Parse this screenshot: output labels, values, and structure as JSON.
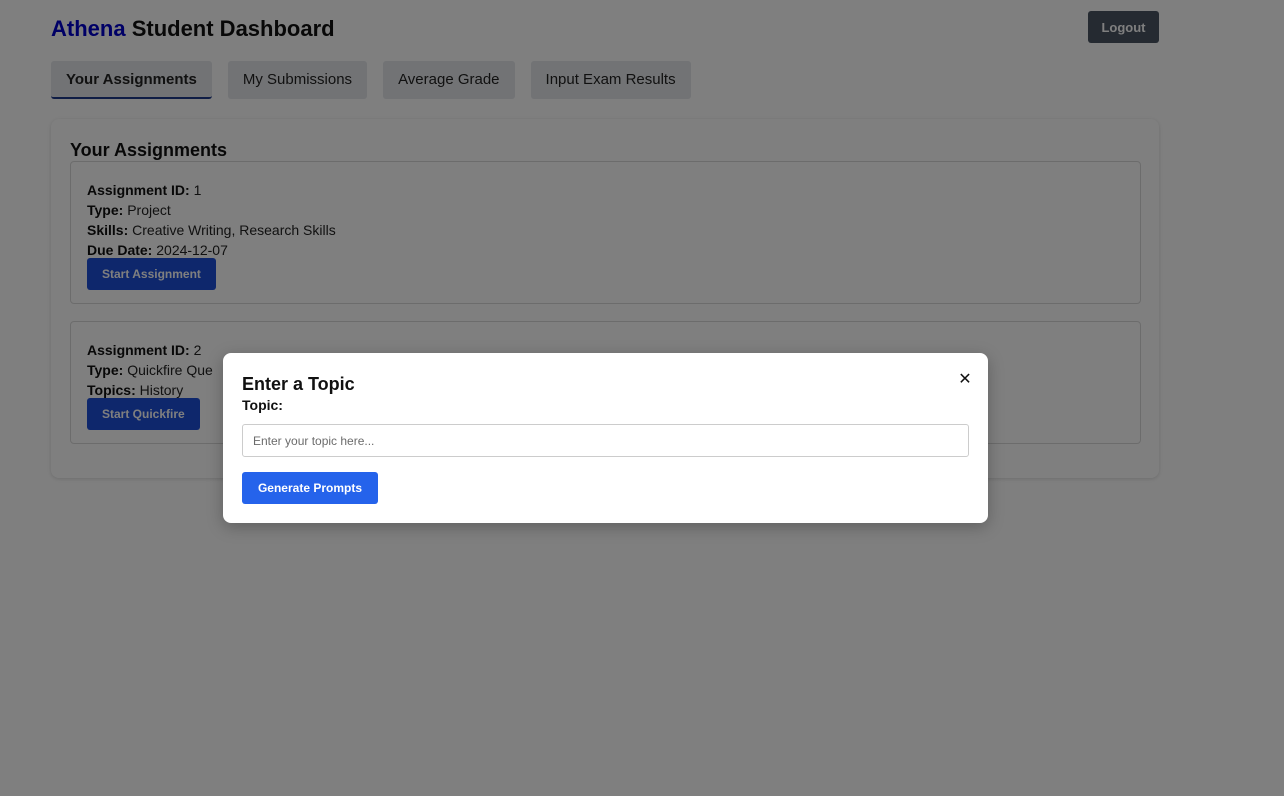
{
  "header": {
    "brand": "Athena",
    "title_rest": "Student Dashboard",
    "logout_label": "Logout"
  },
  "tabs": [
    {
      "label": "Your Assignments",
      "active": true
    },
    {
      "label": "My Submissions",
      "active": false
    },
    {
      "label": "Average Grade",
      "active": false
    },
    {
      "label": "Input Exam Results",
      "active": false
    }
  ],
  "assignments": {
    "section_title": "Your Assignments",
    "items": [
      {
        "id_label": "Assignment ID:",
        "id": "1",
        "type_label": "Type:",
        "type": "Project",
        "skills_label": "Skills:",
        "skills": "Creative Writing, Research Skills",
        "due_label": "Due Date:",
        "due": "2024-12-07",
        "button": "Start Assignment"
      },
      {
        "id_label": "Assignment ID:",
        "id": "2",
        "type_label": "Type:",
        "type": "Quickfire Que",
        "topics_label": "Topics:",
        "topics": "History",
        "button": "Start Quickfire"
      }
    ]
  },
  "modal": {
    "title": "Enter a Topic",
    "close_icon": "close-icon",
    "topic_label": "Topic:",
    "topic_placeholder": "Enter your topic here...",
    "topic_value": "",
    "generate_label": "Generate Prompts"
  },
  "colors": {
    "brand": "#0000cc",
    "primary": "#2563eb",
    "logout": "#4b5563",
    "overlay": "rgba(0,0,0,0.5)"
  }
}
